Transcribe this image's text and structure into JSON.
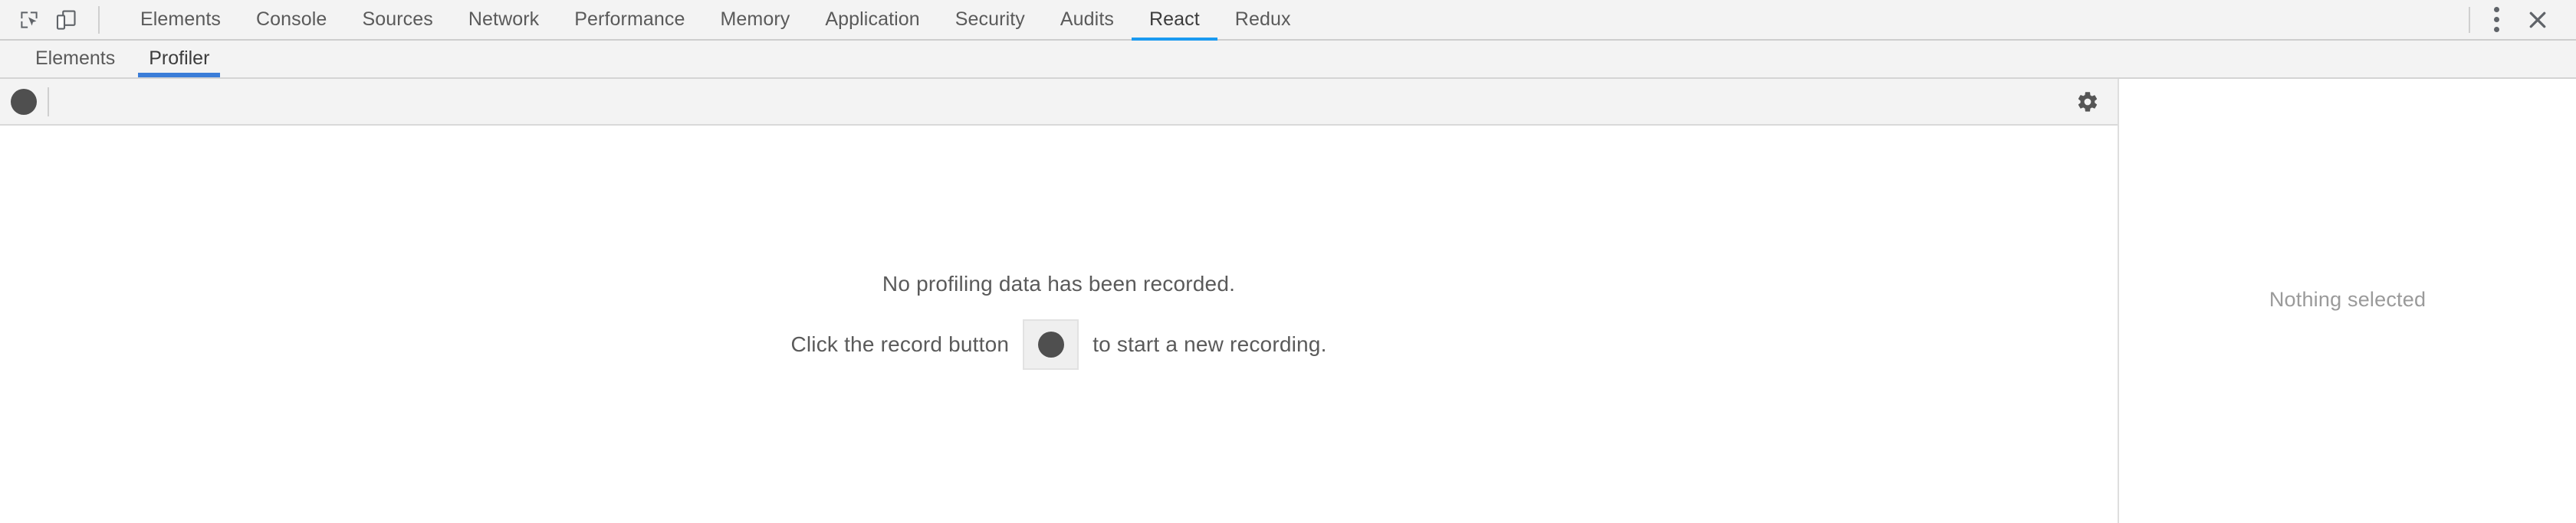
{
  "devtools": {
    "icons": [
      {
        "name": "inspect-element-icon",
        "label": "Inspect element"
      },
      {
        "name": "device-toolbar-icon",
        "label": "Toggle device toolbar"
      }
    ],
    "main_tabs": [
      {
        "label": "Elements",
        "active": false
      },
      {
        "label": "Console",
        "active": false
      },
      {
        "label": "Sources",
        "active": false
      },
      {
        "label": "Network",
        "active": false
      },
      {
        "label": "Performance",
        "active": false
      },
      {
        "label": "Memory",
        "active": false
      },
      {
        "label": "Application",
        "active": false
      },
      {
        "label": "Security",
        "active": false
      },
      {
        "label": "Audits",
        "active": false
      },
      {
        "label": "React",
        "active": true
      },
      {
        "label": "Redux",
        "active": false
      }
    ],
    "more_options_label": "Customize and control DevTools",
    "close_label": "Close DevTools"
  },
  "react_panel": {
    "sub_tabs": [
      {
        "label": "Elements",
        "active": false
      },
      {
        "label": "Profiler",
        "active": true
      }
    ],
    "toolbar": {
      "record_label": "Start profiling",
      "settings_label": "Settings"
    },
    "empty_state": {
      "line1": "No profiling data has been recorded.",
      "line2_prefix": "Click the record button",
      "line2_suffix": "to start a new recording.",
      "record_button_label": "Start profiling"
    },
    "sidebar": {
      "empty_text": "Nothing selected"
    }
  },
  "colors": {
    "chrome_toolbar_bg": "#f3f3f3",
    "react_tab_accent": "#1a9af0",
    "profiler_tab_accent": "#3b7dd8",
    "record_dot": "#4f4f4f",
    "text_primary": "#5a5a5a",
    "text_muted": "#9a9a9a"
  }
}
